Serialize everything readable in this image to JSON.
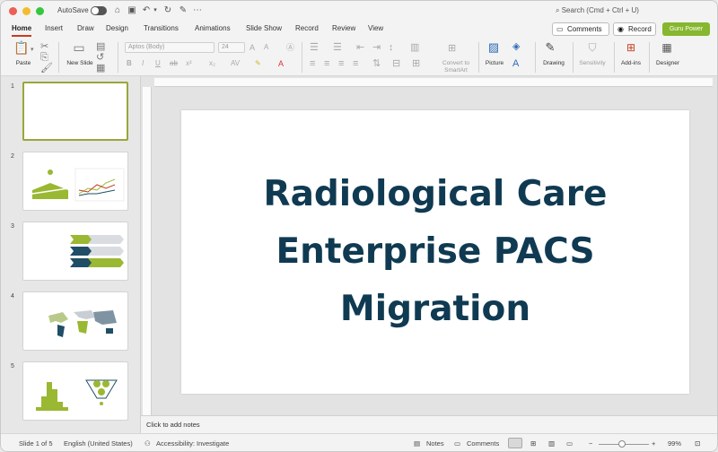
{
  "titlebar": {
    "autosave_label": "AutoSave",
    "search_placeholder": "Search (Cmd + Ctrl + U)"
  },
  "tabs": [
    {
      "label": "Home"
    },
    {
      "label": "Insert"
    },
    {
      "label": "Draw"
    },
    {
      "label": "Design"
    },
    {
      "label": "Transitions"
    },
    {
      "label": "Animations"
    },
    {
      "label": "Slide Show"
    },
    {
      "label": "Record"
    },
    {
      "label": "Review"
    },
    {
      "label": "View"
    }
  ],
  "topbar": {
    "comments_label": "Comments",
    "record_label": "Record",
    "guru_label": "Guru Power"
  },
  "ribbon": {
    "paste_label": "Paste",
    "new_slide_label": "New Slide",
    "font_name": "Aptos (Body)",
    "font_size": "24",
    "convert_label": "Convert to SmartArt",
    "picture_label": "Picture",
    "drawing_label": "Drawing",
    "sensitivity_label": "Sensitivity",
    "addins_label": "Add-ins",
    "designer_label": "Designer"
  },
  "thumbnails": [
    {
      "number": "1"
    },
    {
      "number": "2"
    },
    {
      "number": "3"
    },
    {
      "number": "4"
    },
    {
      "number": "5"
    }
  ],
  "slide": {
    "title_line1": "Radiological Care",
    "title_line2": "Enterprise PACS",
    "title_line3": "Migration"
  },
  "notes_placeholder": "Click to add notes",
  "status": {
    "slide_info": "Slide 1 of 5",
    "language": "English (United States)",
    "accessibility": "Accessibility: Investigate",
    "notes_label": "Notes",
    "comments_label": "Comments",
    "zoom": "99%"
  },
  "colors": {
    "accent": "#c43e1c",
    "guru_green": "#86b72f",
    "title_color": "#0f3a52",
    "thumb_green": "#9ab832",
    "thumb_navy": "#1f4e66"
  }
}
